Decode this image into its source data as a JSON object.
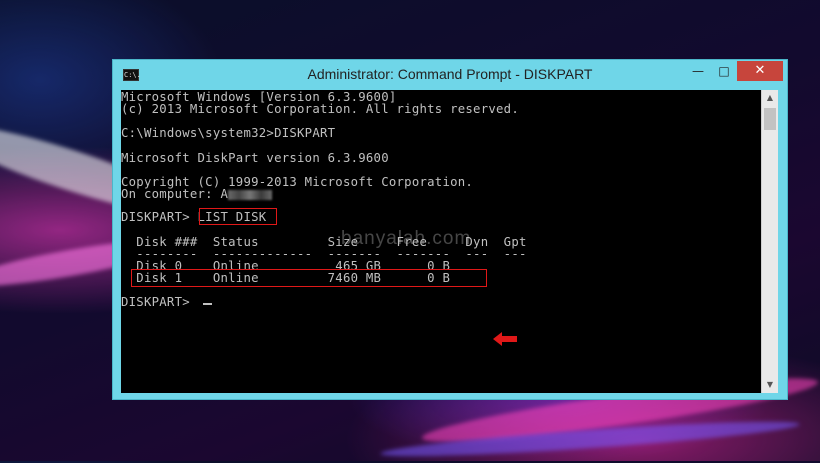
{
  "window": {
    "title": "Administrator: Command Prompt - DISKPART",
    "icon_text": "C:\\.",
    "controls": {
      "minimize": "—",
      "maximize": "□",
      "close": "✕"
    }
  },
  "console": {
    "lines": [
      "Microsoft Windows [Version 6.3.9600]",
      "(c) 2013 Microsoft Corporation. All rights reserved.",
      "",
      "C:\\Windows\\system32>DISKPART",
      "",
      "Microsoft DiskPart version 6.3.9600",
      "",
      "Copyright (C) 1999-2013 Microsoft Corporation.",
      "On computer: A",
      "",
      "DISKPART> LIST DISK",
      "",
      "  Disk ###  Status         Size     Free     Dyn  Gpt",
      "  --------  -------------  -------  -------  ---  ---",
      "  Disk 0    Online          465 GB      0 B",
      "  Disk 1    Online         7460 MB      0 B",
      "",
      "DISKPART> "
    ],
    "prompt_cursor": "_"
  },
  "watermark": "banyalah.com",
  "accent_colors": {
    "highlight": "#e01818",
    "console_text": "#c0c0c0",
    "titlebar": "#6fd6e8",
    "close": "#c7453c"
  }
}
